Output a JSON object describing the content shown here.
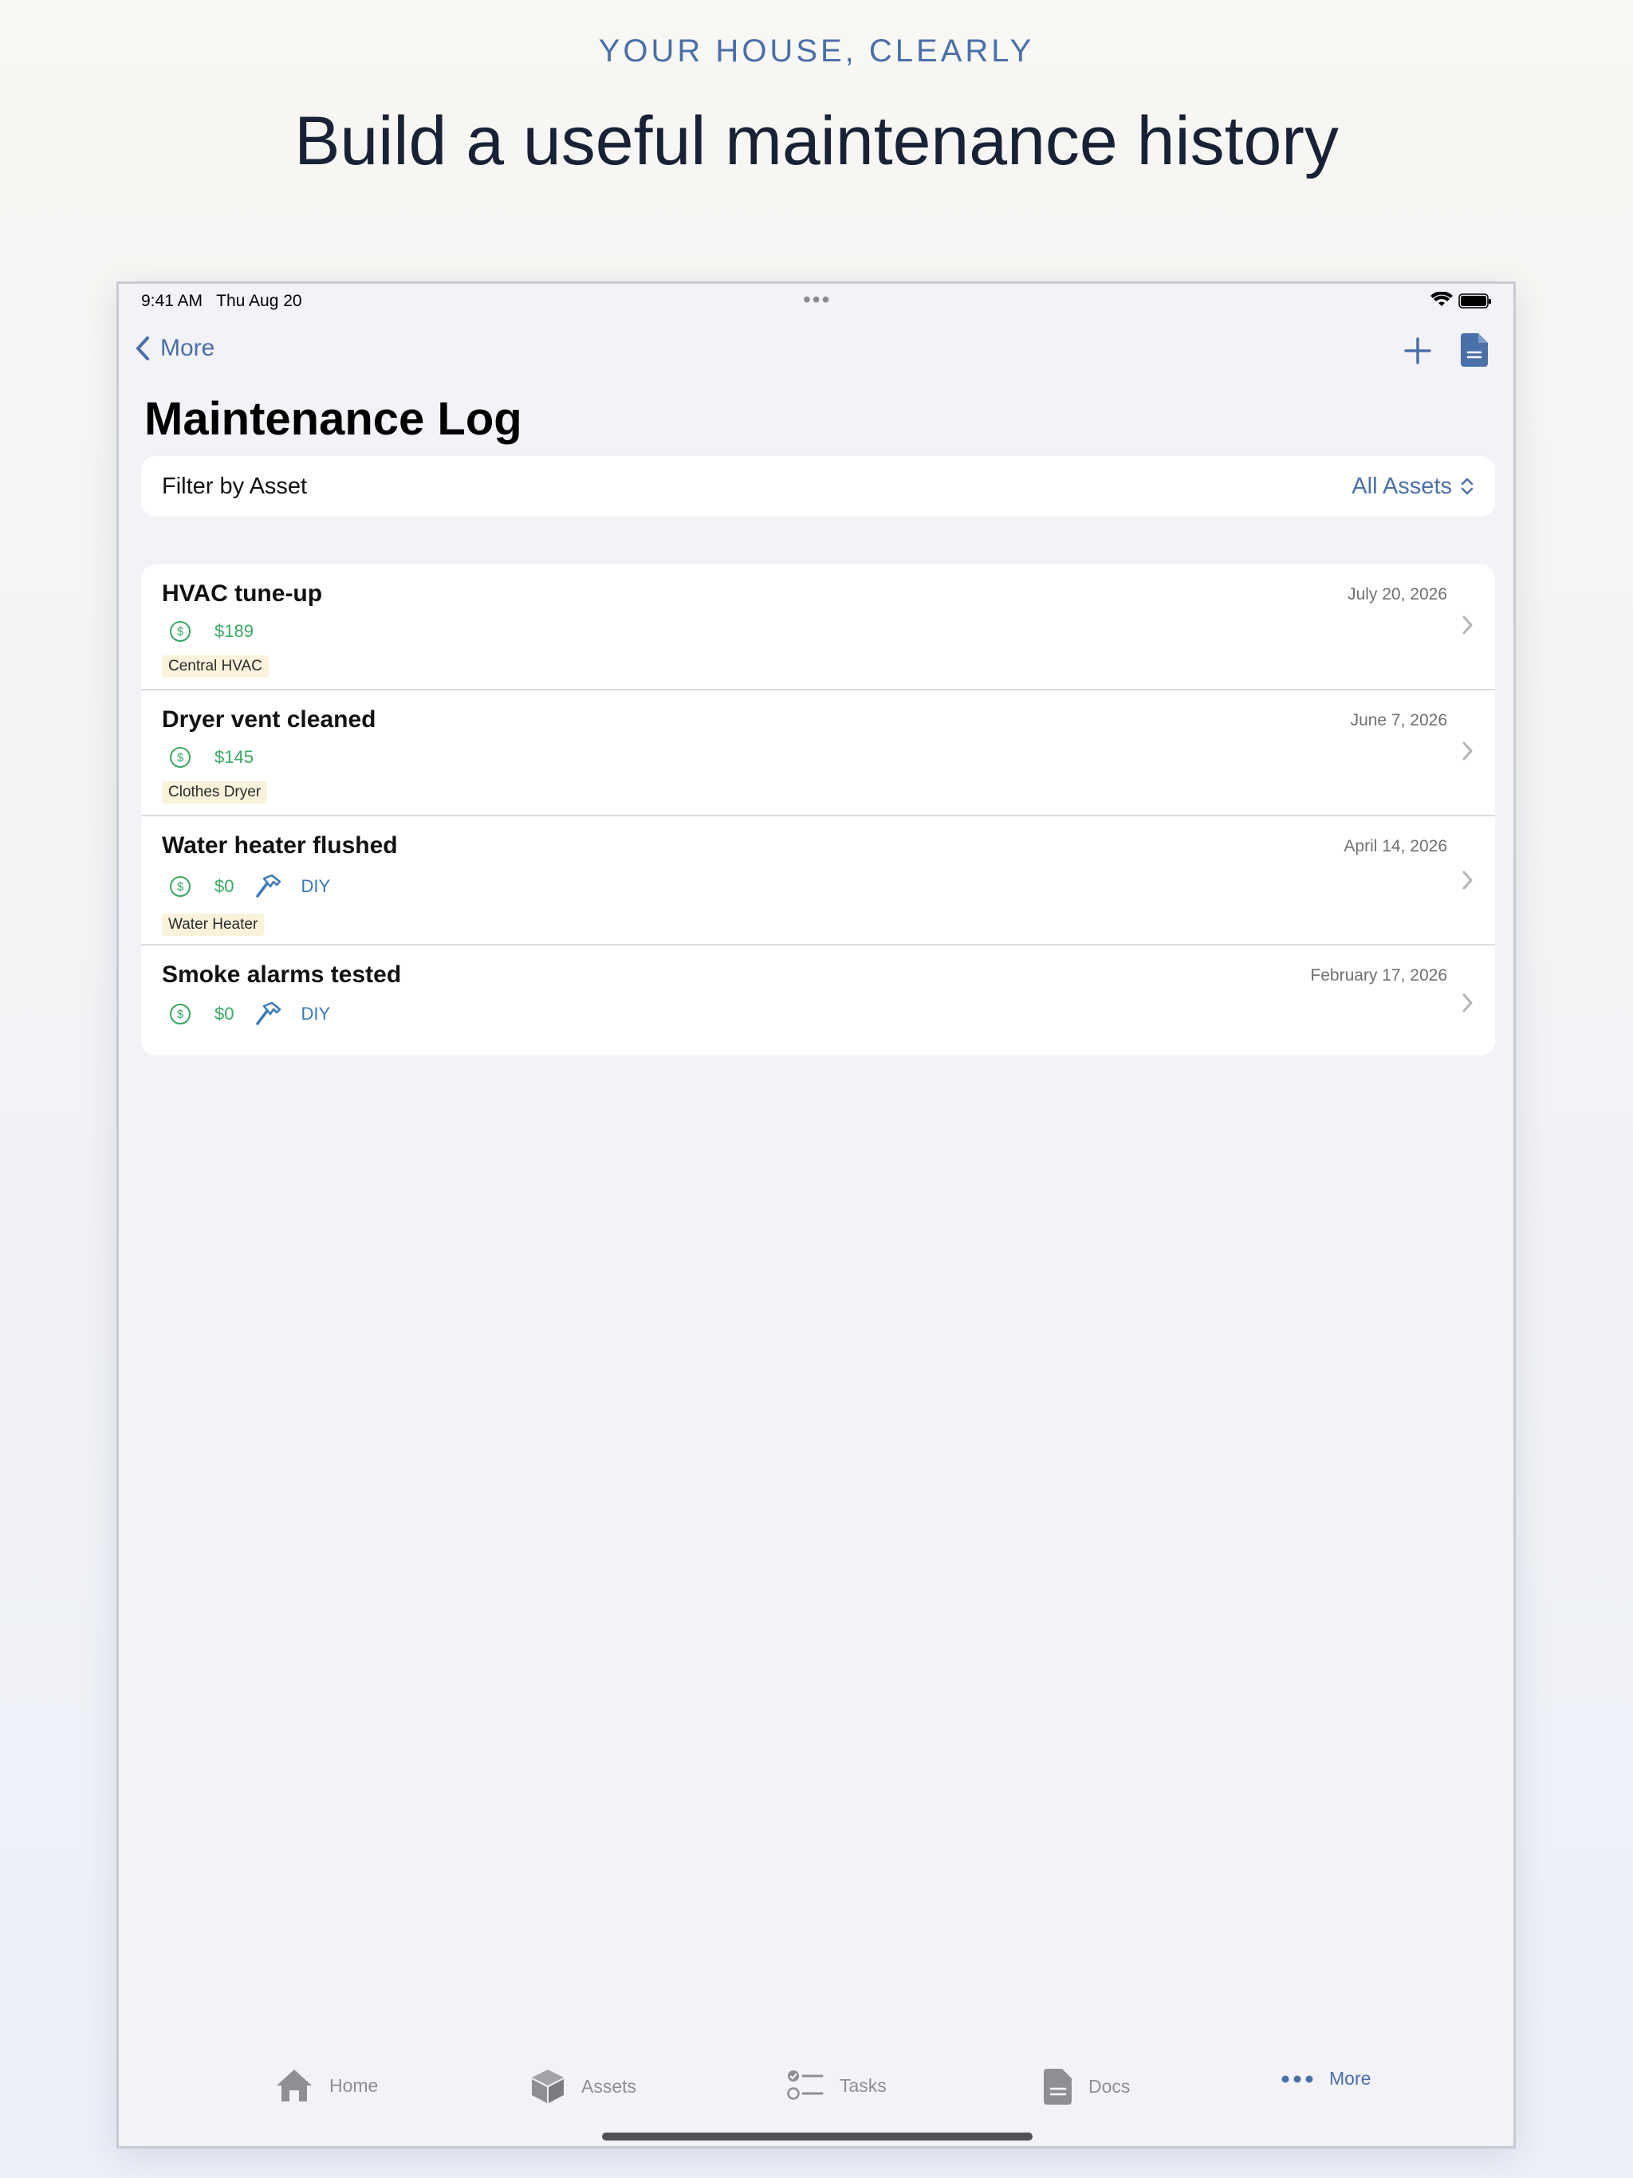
{
  "marketing": {
    "eyebrow": "YOUR HOUSE, CLEARLY",
    "headline": "Build a useful maintenance history"
  },
  "status_bar": {
    "time": "9:41 AM   Thu Aug 20"
  },
  "nav": {
    "back_label": "More",
    "title": "Maintenance Log"
  },
  "filter": {
    "label": "Filter by Asset",
    "value": "All Assets"
  },
  "entries": [
    {
      "name": "HVAC tune-up",
      "date": "July 20, 2026",
      "cost": "$189",
      "diy": "",
      "asset": "Central HVAC"
    },
    {
      "name": "Dryer vent cleaned",
      "date": "June 7, 2026",
      "cost": "$145",
      "diy": "",
      "asset": "Clothes Dryer"
    },
    {
      "name": "Water heater flushed",
      "date": "April 14, 2026",
      "cost": "$0",
      "diy": "DIY",
      "asset": "Water Heater"
    },
    {
      "name": "Smoke alarms tested",
      "date": "February 17, 2026",
      "cost": "$0",
      "diy": "DIY",
      "asset": ""
    }
  ],
  "tabs": [
    {
      "label": "Home",
      "icon": "house-icon"
    },
    {
      "label": "Assets",
      "icon": "cube-icon"
    },
    {
      "label": "Tasks",
      "icon": "checklist-icon"
    },
    {
      "label": "Docs",
      "icon": "document-icon"
    },
    {
      "label": "More",
      "icon": "ellipsis-icon"
    }
  ],
  "colors": {
    "accent": "#4a70a8",
    "cost": "#39a862",
    "diy": "#3b78b8",
    "tag_bg": "#fbf2dc"
  }
}
